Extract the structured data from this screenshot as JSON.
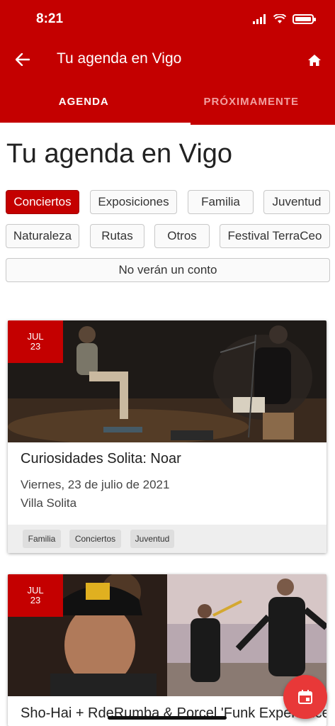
{
  "status_bar": {
    "time": "8:21"
  },
  "app_bar": {
    "title": "Tu agenda en Vigo"
  },
  "tabs": [
    {
      "label": "AGENDA",
      "active": true
    },
    {
      "label": "PRÓXIMAMENTE",
      "active": false
    }
  ],
  "page_title": "Tu agenda en Vigo",
  "filters": {
    "selected": "Conciertos",
    "chips": [
      "Conciertos",
      "Exposiciones",
      "Familia",
      "Juventud",
      "Naturaleza",
      "Rutas",
      "Otros",
      "Festival TerraCeo",
      "No verán un conto"
    ]
  },
  "events": [
    {
      "date_month": "JUL",
      "date_day": "23",
      "title": "Curiosidades Solita: Noar",
      "date_text": "Viernes, 23 de julio de 2021",
      "venue": "Villa Solita",
      "tags": [
        "Familia",
        "Conciertos",
        "Juventud"
      ]
    },
    {
      "date_month": "JUL",
      "date_day": "23",
      "title": "Sho-Hai + RdeRumba & Porcel 'Funk Experience'"
    }
  ],
  "colors": {
    "primary": "#c40000",
    "fab": "#e83838"
  },
  "icons": {
    "back": "arrow-left-icon",
    "home": "home-icon",
    "fab": "calendar-icon"
  }
}
